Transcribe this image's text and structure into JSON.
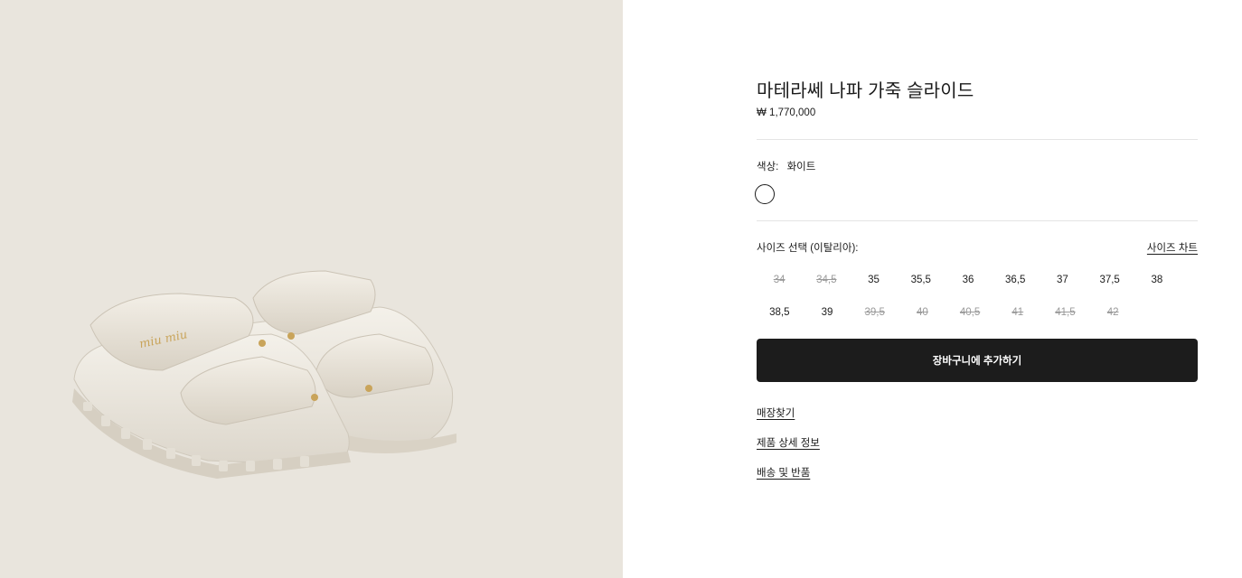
{
  "product": {
    "image_alt": "화이트 퀼팅 나파 가죽 슬라이드",
    "logo_text": "miu miu",
    "title": "마테라쎄 나파 가죽 슬라이드",
    "price": "₩ 1,770,000"
  },
  "color": {
    "label": "색상:",
    "value": "화이트",
    "swatch_color": "#ffffff"
  },
  "size": {
    "label": "사이즈 선택 (이탈리아):",
    "chart_link": "사이즈 차트",
    "rows": [
      [
        {
          "label": "34",
          "available": false
        },
        {
          "label": "34,5",
          "available": false
        },
        {
          "label": "35",
          "available": true
        },
        {
          "label": "35,5",
          "available": true
        },
        {
          "label": "36",
          "available": true
        },
        {
          "label": "36,5",
          "available": true
        },
        {
          "label": "37",
          "available": true
        },
        {
          "label": "37,5",
          "available": true
        },
        {
          "label": "38",
          "available": true
        }
      ],
      [
        {
          "label": "38,5",
          "available": true
        },
        {
          "label": "39",
          "available": true
        },
        {
          "label": "39,5",
          "available": false
        },
        {
          "label": "40",
          "available": false
        },
        {
          "label": "40,5",
          "available": false
        },
        {
          "label": "41",
          "available": false
        },
        {
          "label": "41,5",
          "available": false
        },
        {
          "label": "42",
          "available": false
        }
      ]
    ]
  },
  "actions": {
    "add_to_cart": "장바구니에 추가하기"
  },
  "links": {
    "find_store": "매장찾기",
    "product_details": "제품 상세 정보",
    "shipping_returns": "배송 및 반품"
  },
  "colors": {
    "image_background": "#e9e5dd",
    "primary_button": "#1c1c1c",
    "unavailable_text": "#9a9a9a"
  }
}
